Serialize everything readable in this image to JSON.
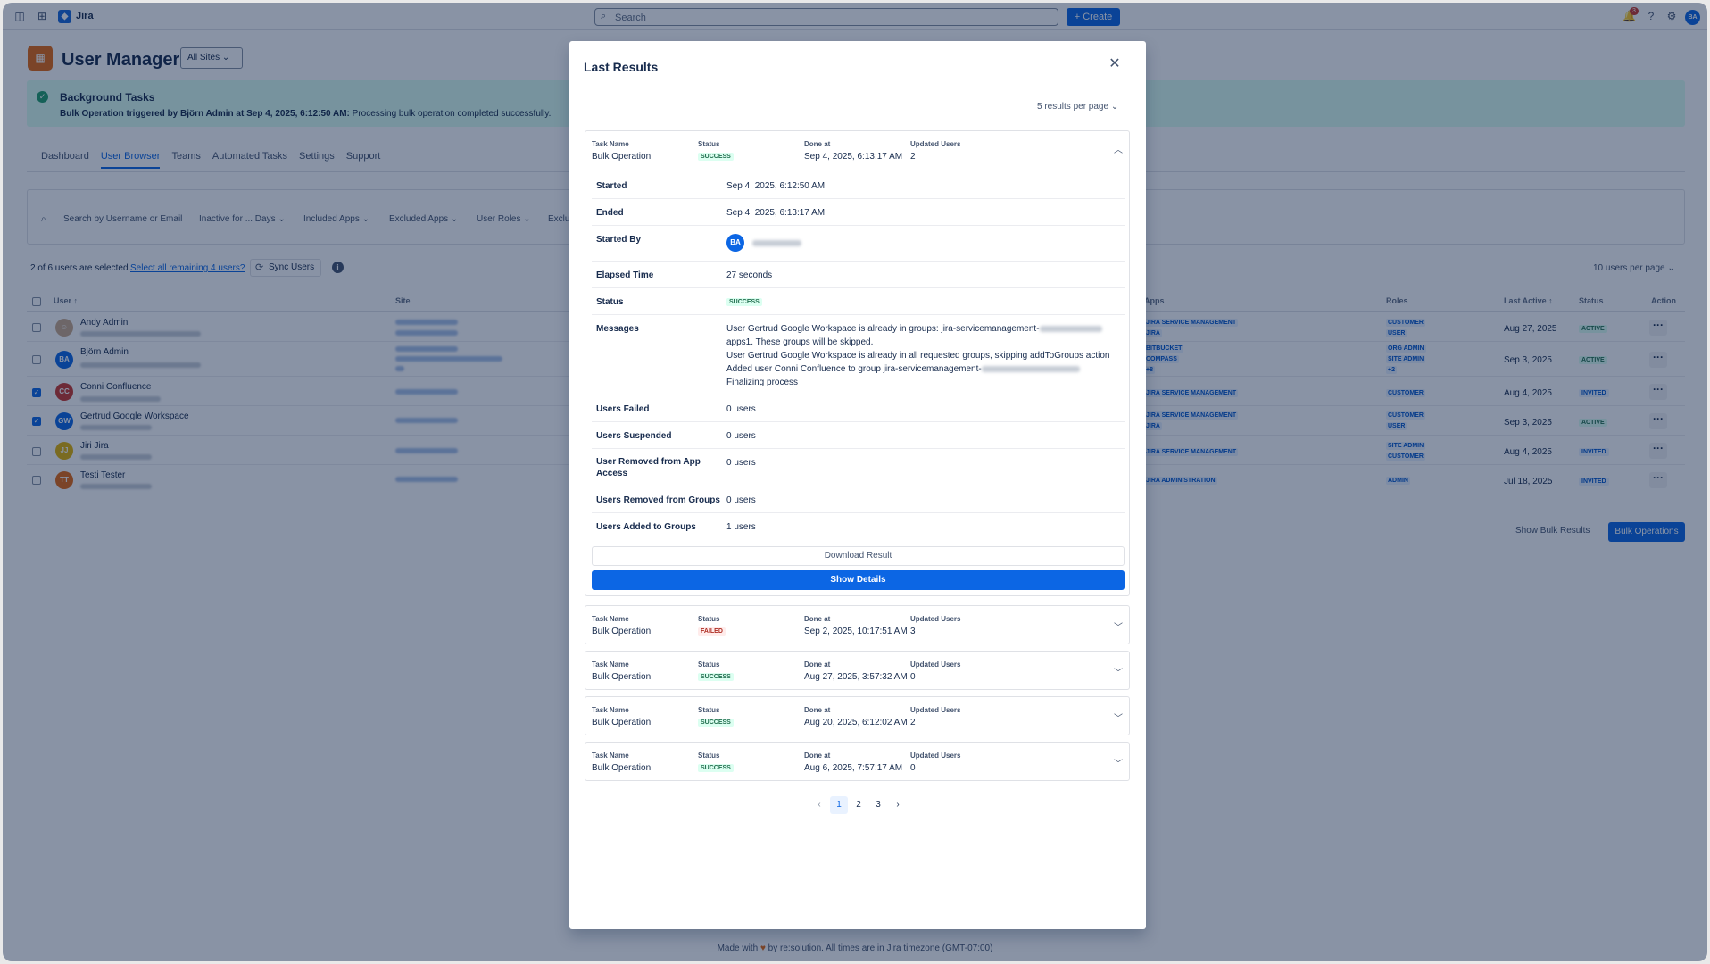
{
  "topnav": {
    "app_name": "Jira",
    "search_placeholder": "Search",
    "create_label": "+ Create",
    "notification_count": "3",
    "avatar_initials": "BA"
  },
  "header": {
    "title": "User Manager",
    "site_select": "All Sites ⌄"
  },
  "banner": {
    "title": "Background Tasks",
    "trigger": "Bulk Operation triggered by Björn Admin at Sep 4, 2025, 6:12:50 AM:",
    "message": "Processing bulk operation completed successfully."
  },
  "tabs": [
    "Dashboard",
    "User Browser",
    "Teams",
    "Automated Tasks",
    "Settings",
    "Support"
  ],
  "filters": {
    "search_placeholder": "Search by Username or Email",
    "inactive": "Inactive for ... Days ⌄",
    "included_apps": "Included Apps ⌄",
    "excluded_apps": "Excluded Apps ⌄",
    "user_roles": "User Roles ⌄",
    "exclu": "Exclu"
  },
  "selection": {
    "info": "2 of 6 users are selected.",
    "select_all_link": "Select all remaining 4 users?",
    "sync_label": "Sync Users",
    "per_page": "10 users per page ⌄"
  },
  "table": {
    "headers": {
      "user": "User ↑",
      "site": "Site",
      "apps": "Apps",
      "roles": "Roles",
      "last_active": "Last Active ↕",
      "status": "Status",
      "action": "Action"
    },
    "rows": [
      {
        "initials": "",
        "name": "Andy Admin",
        "color": "#c9a98a",
        "checked": false,
        "apps": [
          "JIRA SERVICE MANAGEMENT",
          "JIRA"
        ],
        "roles": [
          "CUSTOMER",
          "USER"
        ],
        "last_active": "Aug 27, 2025",
        "status": "ACTIVE"
      },
      {
        "initials": "BA",
        "name": "Björn Admin",
        "color": "#0c66e4",
        "checked": false,
        "apps": [
          "BITBUCKET",
          "COMPASS",
          "+8"
        ],
        "roles": [
          "ORG ADMIN",
          "SITE ADMIN",
          "+2"
        ],
        "last_active": "Sep 3, 2025",
        "status": "ACTIVE"
      },
      {
        "initials": "CC",
        "name": "Conni Confluence",
        "color": "#c9372c",
        "checked": true,
        "apps": [
          "JIRA SERVICE MANAGEMENT"
        ],
        "roles": [
          "CUSTOMER"
        ],
        "last_active": "Aug 4, 2025",
        "status": "INVITED"
      },
      {
        "initials": "GW",
        "name": "Gertrud Google Workspace",
        "color": "#0c66e4",
        "checked": true,
        "apps": [
          "JIRA SERVICE MANAGEMENT",
          "JIRA"
        ],
        "roles": [
          "CUSTOMER",
          "USER"
        ],
        "last_active": "Sep 3, 2025",
        "status": "ACTIVE"
      },
      {
        "initials": "JJ",
        "name": "Jiri Jira",
        "color": "#e2b203",
        "checked": false,
        "apps": [
          "JIRA SERVICE MANAGEMENT"
        ],
        "roles": [
          "SITE ADMIN",
          "CUSTOMER"
        ],
        "last_active": "Aug 4, 2025",
        "status": "INVITED"
      },
      {
        "initials": "TT",
        "name": "Testi Tester",
        "color": "#e56910",
        "checked": false,
        "apps": [
          "JIRA ADMINISTRATION"
        ],
        "roles": [
          "ADMIN"
        ],
        "last_active": "Jul 18, 2025",
        "status": "INVITED"
      }
    ]
  },
  "bottom_buttons": {
    "show_bulk_results": "Show Bulk Results",
    "bulk_operations": "Bulk Operations"
  },
  "footer": {
    "made_with": "Made with",
    "heart": "♥",
    "rest": "by re:solution. All times are in Jira timezone (GMT-07:00)"
  },
  "modal": {
    "title": "Last Results",
    "close": "✕",
    "results_per_page": "5 results per page ⌄",
    "labels": {
      "task_name": "Task Name",
      "status": "Status",
      "done_at": "Done at",
      "updated_users": "Updated Users"
    },
    "tasks": [
      {
        "name": "Bulk Operation",
        "status": "SUCCESS",
        "done_at": "Sep 4, 2025, 6:13:17 AM",
        "updated": "2",
        "expanded": true
      },
      {
        "name": "Bulk Operation",
        "status": "FAILED",
        "done_at": "Sep 2, 2025, 10:17:51 AM",
        "updated": "3",
        "expanded": false
      },
      {
        "name": "Bulk Operation",
        "status": "SUCCESS",
        "done_at": "Aug 27, 2025, 3:57:32 AM",
        "updated": "0",
        "expanded": false
      },
      {
        "name": "Bulk Operation",
        "status": "SUCCESS",
        "done_at": "Aug 20, 2025, 6:12:02 AM",
        "updated": "2",
        "expanded": false
      },
      {
        "name": "Bulk Operation",
        "status": "SUCCESS",
        "done_at": "Aug 6, 2025, 7:57:17 AM",
        "updated": "0",
        "expanded": false
      }
    ],
    "details": {
      "started_key": "Started",
      "started": "Sep 4, 2025, 6:12:50 AM",
      "ended_key": "Ended",
      "ended": "Sep 4, 2025, 6:13:17 AM",
      "started_by_key": "Started By",
      "started_by_initials": "BA",
      "elapsed_key": "Elapsed Time",
      "elapsed": "27 seconds",
      "status_key": "Status",
      "status": "SUCCESS",
      "messages_key": "Messages",
      "messages": [
        "User Gertrud Google Workspace is already in groups: jira-servicemanagement-",
        "apps1. These groups will be skipped.",
        "User Gertrud Google Workspace is already in all requested groups, skipping addToGroups action",
        "Added user Conni Confluence to group jira-servicemanagement-",
        "Finalizing process"
      ],
      "failed_key": "Users Failed",
      "failed": "0 users",
      "suspended_key": "Users Suspended",
      "suspended": "0 users",
      "removed_app_key": "User Removed from App Access",
      "removed_app": "0 users",
      "removed_groups_key": "Users Removed from Groups",
      "removed_groups": "0 users",
      "added_groups_key": "Users Added to Groups",
      "added_groups": "1 users"
    },
    "download_label": "Download Result",
    "show_details_label": "Show Details",
    "pagination": {
      "prev": "‹",
      "pages": [
        "1",
        "2",
        "3"
      ],
      "next": "›"
    }
  }
}
